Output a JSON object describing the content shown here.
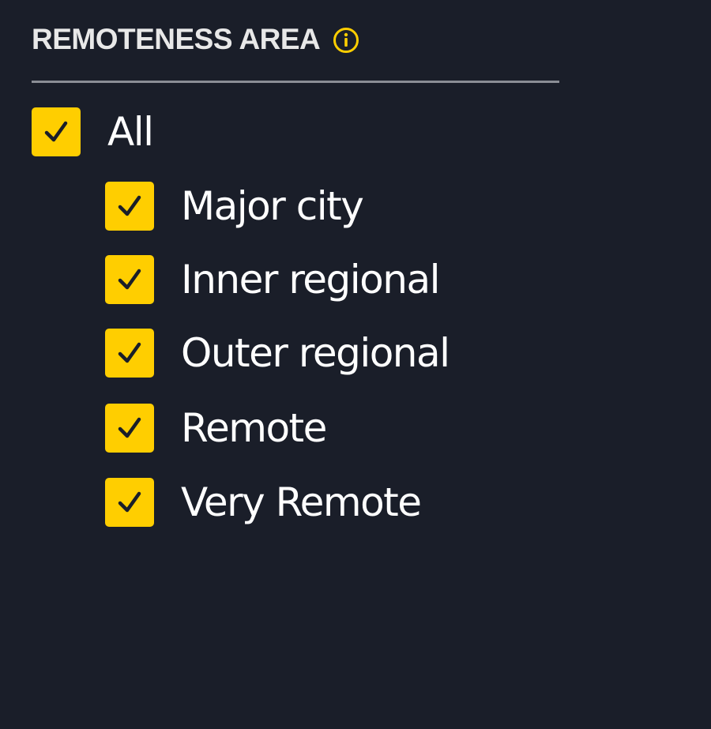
{
  "section": {
    "title": "REMOTENESS AREA",
    "info_icon": "info-circle-icon"
  },
  "colors": {
    "background": "#1a1e29",
    "checkbox": "#ffce00",
    "checkmark": "#1a1e29",
    "label": "#ffffff",
    "divider": "#8a8d95"
  },
  "options": {
    "all": {
      "label": "All",
      "checked": true
    },
    "items": [
      {
        "label": "Major city",
        "checked": true
      },
      {
        "label": "Inner regional",
        "checked": true
      },
      {
        "label": "Outer regional",
        "checked": true
      },
      {
        "label": "Remote",
        "checked": true
      },
      {
        "label": "Very Remote",
        "checked": true
      }
    ]
  }
}
